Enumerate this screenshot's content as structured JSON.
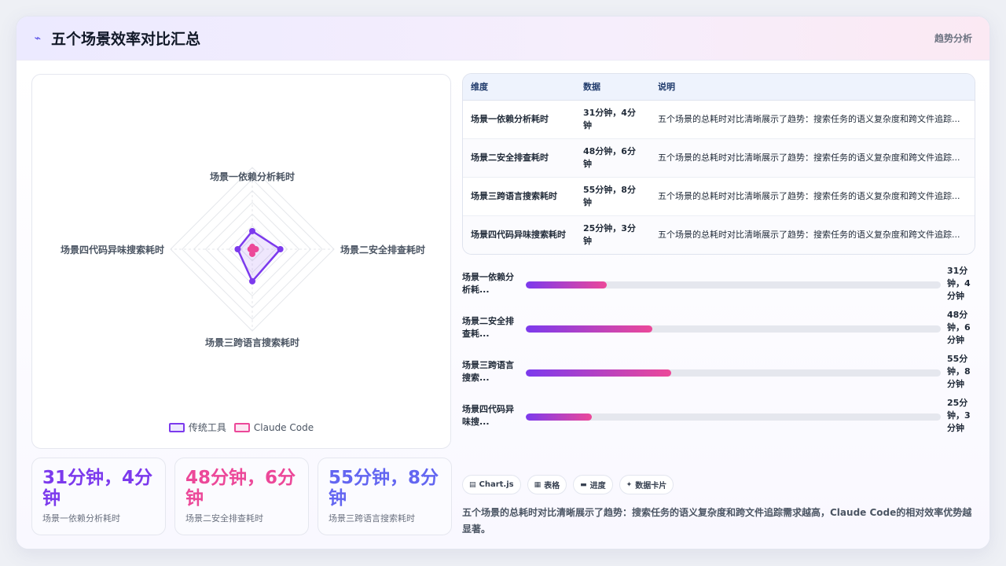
{
  "header": {
    "title": "五个场景效率对比汇总",
    "tag": "趋势分析",
    "icon": "pulse-icon"
  },
  "chart_data": {
    "type": "radar",
    "categories": [
      "场景一依赖分析耗时",
      "场景二安全排查耗时",
      "场景三跨语言搜索耗时",
      "场景四代码异味搜索耗时"
    ],
    "series": [
      {
        "name": "传统工具",
        "values": [
          31,
          48,
          55,
          25
        ],
        "color": "#7c3aed"
      },
      {
        "name": "Claude Code",
        "values": [
          4,
          6,
          8,
          3
        ],
        "color": "#ec4899"
      }
    ],
    "rmax": 140,
    "grid": true,
    "legend": "bottom"
  },
  "stats": [
    {
      "value": "31分钟，4分钟",
      "label": "场景一依赖分析耗时",
      "color": "#7c3aed"
    },
    {
      "value": "48分钟，6分钟",
      "label": "场景二安全排查耗时",
      "color": "#ec4899"
    },
    {
      "value": "55分钟，8分钟",
      "label": "场景三跨语言搜索耗时",
      "color": "#6366f1"
    }
  ],
  "table": {
    "headers": [
      "维度",
      "数据",
      "说明"
    ],
    "rows": [
      [
        "场景一依赖分析耗时",
        "31分钟，4分钟",
        "五个场景的总耗时对比清晰展示了趋势：搜索任务的语义复杂度和跨文件追踪..."
      ],
      [
        "场景二安全排查耗时",
        "48分钟，6分钟",
        "五个场景的总耗时对比清晰展示了趋势：搜索任务的语义复杂度和跨文件追踪..."
      ],
      [
        "场景三跨语言搜索耗时",
        "55分钟，8分钟",
        "五个场景的总耗时对比清晰展示了趋势：搜索任务的语义复杂度和跨文件追踪..."
      ],
      [
        "场景四代码异味搜索耗时",
        "25分钟，3分钟",
        "五个场景的总耗时对比清晰展示了趋势：搜索任务的语义复杂度和跨文件追踪..."
      ]
    ]
  },
  "progress": [
    {
      "label": "场景一依赖分析耗...",
      "value": "31分钟，4分钟",
      "fill": 0.196
    },
    {
      "label": "场景二安全排查耗...",
      "value": "48分钟，6分钟",
      "fill": 0.305
    },
    {
      "label": "场景三跨语言搜索...",
      "value": "55分钟，8分钟",
      "fill": 0.35
    },
    {
      "label": "场景四代码异味搜...",
      "value": "25分钟，3分钟",
      "fill": 0.159
    }
  ],
  "chips": [
    {
      "icon": "chart-icon",
      "glyph": "▤",
      "label": "Chart.js"
    },
    {
      "icon": "table-icon",
      "glyph": "▦",
      "label": "表格"
    },
    {
      "icon": "progress-icon",
      "glyph": "▬",
      "label": "进度"
    },
    {
      "icon": "card-icon",
      "glyph": "✦",
      "label": "数据卡片"
    }
  ],
  "summary": "五个场景的总耗时对比清晰展示了趋势：搜索任务的语义复杂度和跨文件追踪需求越高，Claude Code的相对效率优势越显著。"
}
